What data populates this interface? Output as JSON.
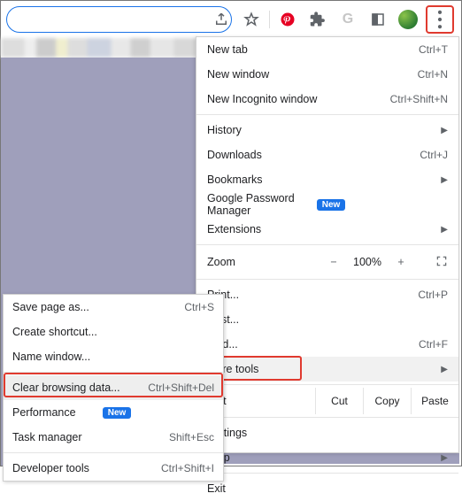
{
  "toolbar": {
    "icons": [
      "share-icon",
      "star-icon",
      "pinterest-icon",
      "extensions-icon",
      "google-icon",
      "reader-icon",
      "avatar",
      "more-icon"
    ]
  },
  "menu": {
    "new_tab": "New tab",
    "new_tab_sc": "Ctrl+T",
    "new_window": "New window",
    "new_window_sc": "Ctrl+N",
    "new_incog": "New Incognito window",
    "new_incog_sc": "Ctrl+Shift+N",
    "history": "History",
    "downloads": "Downloads",
    "downloads_sc": "Ctrl+J",
    "bookmarks": "Bookmarks",
    "gpm": "Google Password Manager",
    "gpm_badge": "New",
    "extensions": "Extensions",
    "zoom": "Zoom",
    "zoom_val": "100%",
    "print": "Print...",
    "print_sc": "Ctrl+P",
    "cast": "Cast...",
    "find": "Find...",
    "find_sc": "Ctrl+F",
    "more_tools": "More tools",
    "edit": "Edit",
    "cut": "Cut",
    "copy": "Copy",
    "paste": "Paste",
    "settings": "Settings",
    "help": "Help",
    "exit": "Exit"
  },
  "submenu": {
    "save_as": "Save page as...",
    "save_as_sc": "Ctrl+S",
    "create_shortcut": "Create shortcut...",
    "name_window": "Name window...",
    "clear_data": "Clear browsing data...",
    "clear_data_sc": "Ctrl+Shift+Del",
    "performance": "Performance",
    "perf_badge": "New",
    "task_mgr": "Task manager",
    "task_mgr_sc": "Shift+Esc",
    "dev_tools": "Developer tools",
    "dev_tools_sc": "Ctrl+Shift+I"
  }
}
